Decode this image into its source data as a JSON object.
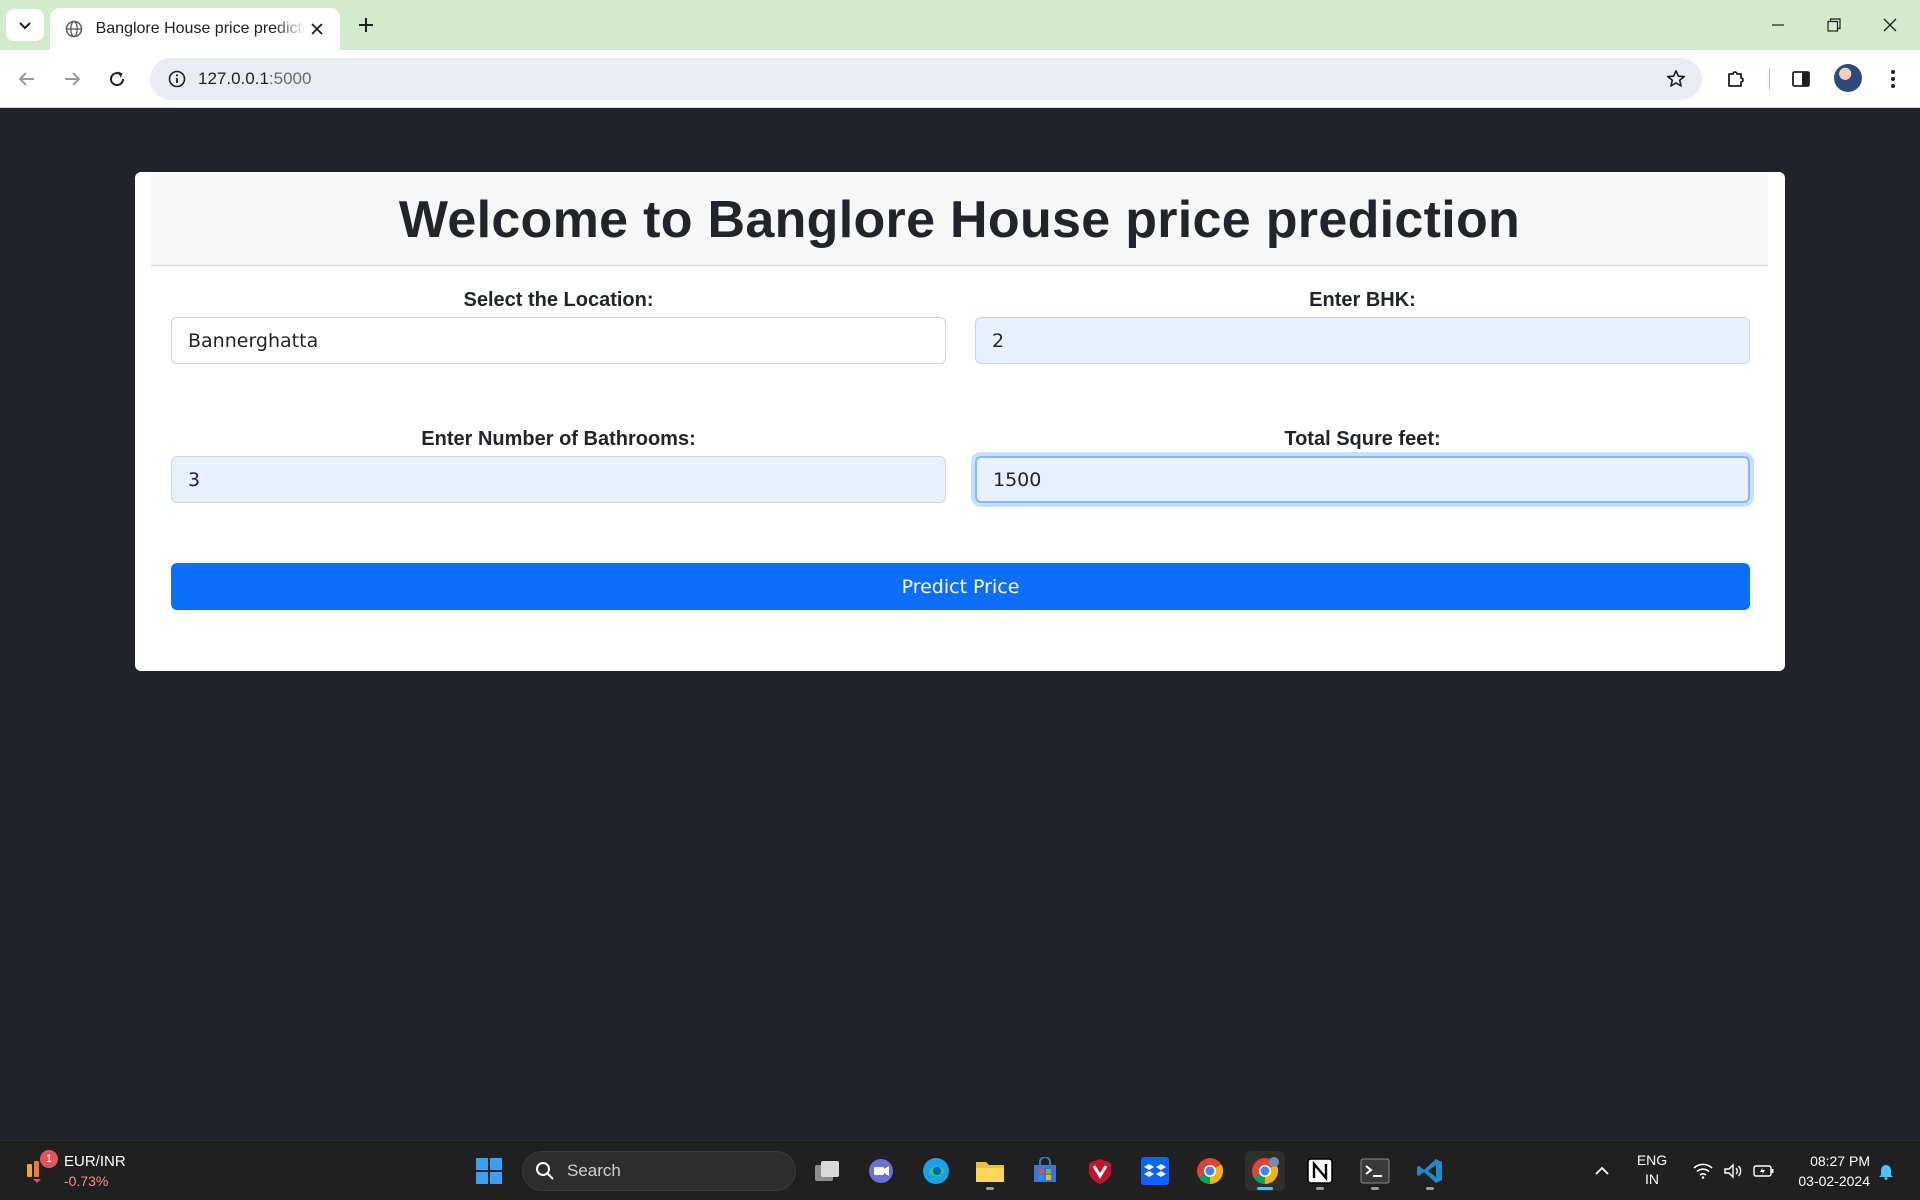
{
  "browser": {
    "tab_title": "Banglore House price prediction",
    "url_host": "127.0.0.1",
    "url_port": ":5000"
  },
  "page": {
    "title": "Welcome to Banglore House price prediction",
    "location": {
      "label": "Select the Location:",
      "value": "Bannerghatta"
    },
    "bhk": {
      "label": "Enter BHK:",
      "value": "2"
    },
    "bathrooms": {
      "label": "Enter Number of Bathrooms:",
      "value": "3"
    },
    "sqft": {
      "label": "Total Squre feet:",
      "value": "1500"
    },
    "predict_button": "Predict Price"
  },
  "taskbar": {
    "widget": {
      "badge": "1",
      "name": "EUR/INR",
      "change": "-0.73%"
    },
    "search_label": "Search",
    "language": {
      "line1": "ENG",
      "line2": "IN"
    },
    "time": "08:27 PM",
    "date": "03-02-2024"
  },
  "colors": {
    "page_bg": "#212529",
    "primary_button": "#0d6efd",
    "tabstrip": "#d3ebcd",
    "autofill": "#e8f0fe"
  },
  "icons": [
    "tab-search-icon",
    "globe-icon",
    "close-icon",
    "plus-icon",
    "minimize-icon",
    "restore-icon",
    "back-icon",
    "forward-icon",
    "reload-icon",
    "site-info-icon",
    "star-icon",
    "extensions-icon",
    "side-panel-icon",
    "menu-icon",
    "windows-start-icon",
    "search-icon",
    "task-view-icon",
    "meet-icon",
    "edge-icon",
    "file-explorer-icon",
    "store-icon",
    "mcafee-icon",
    "dropbox-icon",
    "chrome-icon",
    "notion-icon",
    "terminal-icon",
    "vscode-icon",
    "chevron-up-icon",
    "wifi-icon",
    "volume-icon",
    "battery-icon",
    "notification-bell-icon"
  ]
}
